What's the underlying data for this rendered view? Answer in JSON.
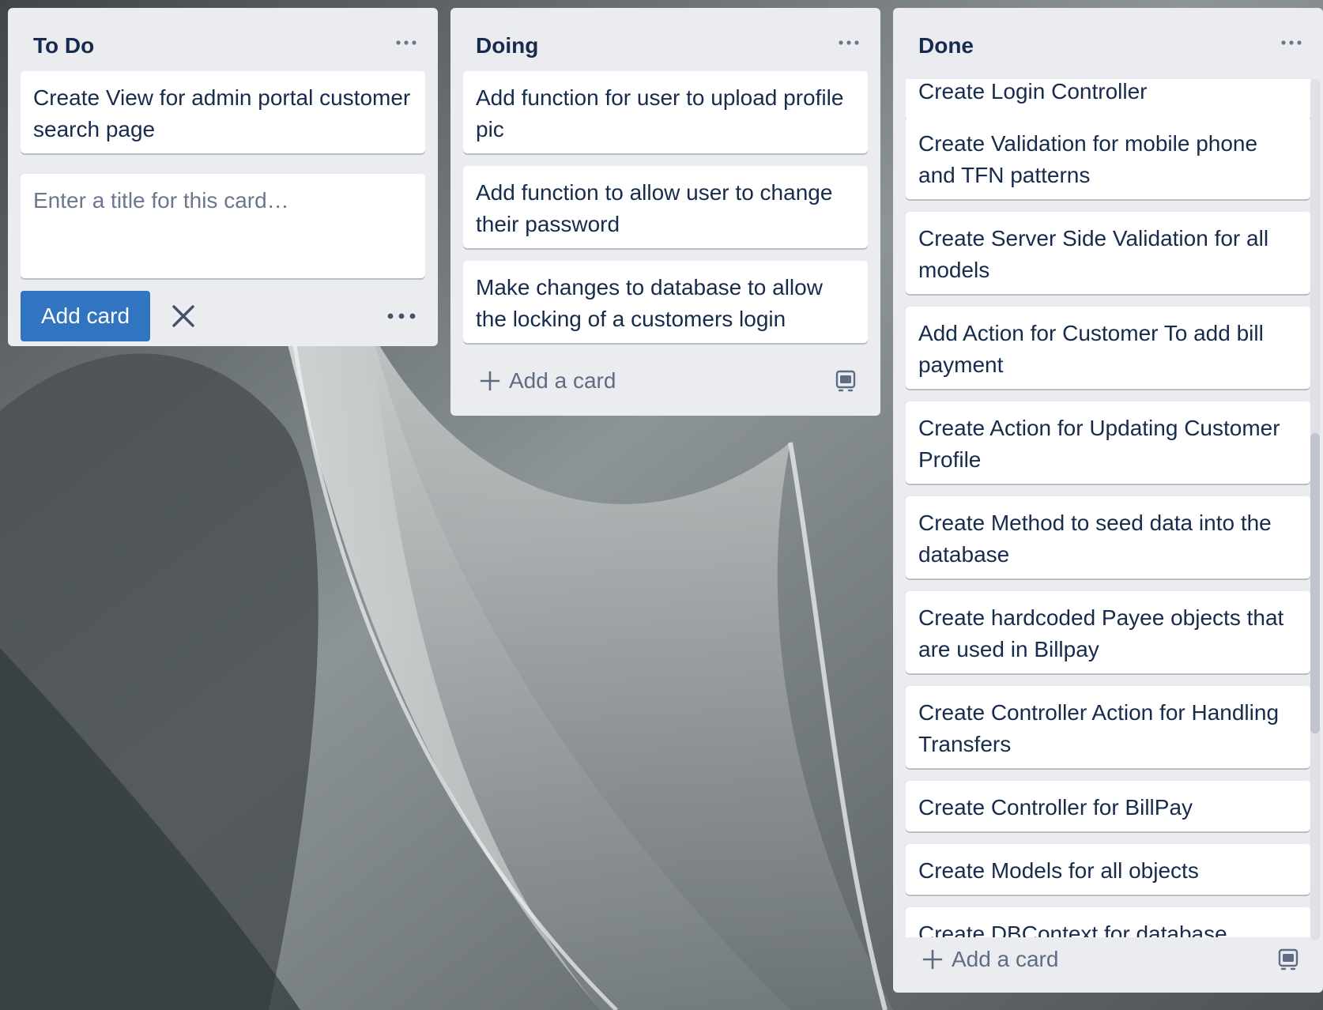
{
  "lists": [
    {
      "title": "To Do",
      "cards": [
        "Create View for admin portal customer search page"
      ],
      "composer": {
        "placeholder": "Enter a title for this card…",
        "add_button": "Add card"
      }
    },
    {
      "title": "Doing",
      "cards": [
        "Add function for user to upload profile pic",
        "Add function to allow user to change their password",
        "Make changes to database to allow the locking of a customers login"
      ],
      "add_card_label": "Add a card"
    },
    {
      "title": "Done",
      "cards": [
        "Create Login Controller",
        "Create Validation for mobile phone and TFN patterns",
        "Create Server Side Validation for all models",
        "Add Action for Customer To add bill payment",
        "Create Action for Updating Customer Profile",
        "Create Method to seed data into the database",
        "Create hardcoded Payee objects that are used in Billpay",
        "Create Controller Action for Handling Transfers",
        "Create Controller for BillPay",
        "Create Models for all objects",
        "Create DBContext for database"
      ],
      "add_card_label": "Add a card"
    }
  ],
  "icons": {
    "list_menu": "ellipsis-icon",
    "close": "close-icon",
    "add": "plus-icon",
    "template": "card-template-icon"
  },
  "colors": {
    "list_bg": "#ebecf0",
    "card_text": "#172b4d",
    "primary_button": "#3174c0",
    "muted_text": "#5e6c84"
  }
}
